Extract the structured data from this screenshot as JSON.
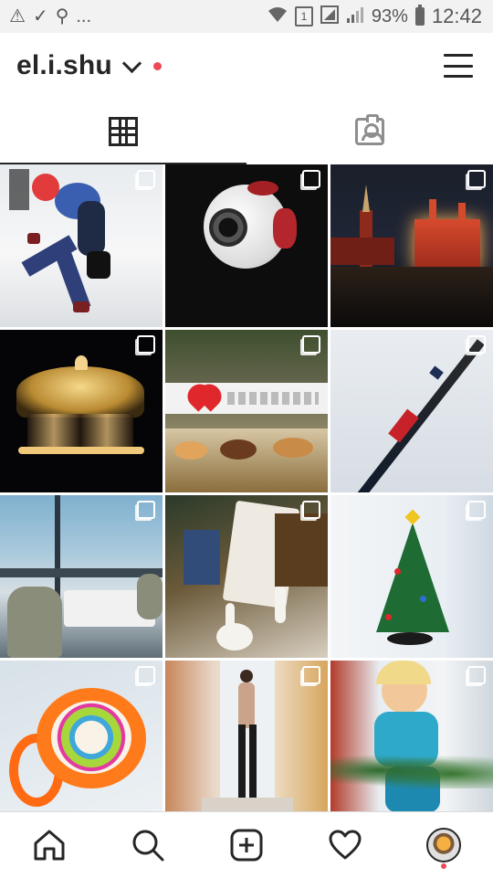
{
  "status_bar": {
    "left_icons": [
      "warning-icon",
      "check-icon",
      "search-icon"
    ],
    "ellipsis": "...",
    "sim_label": "1",
    "battery_percent": "93%",
    "time": "12:42"
  },
  "header": {
    "username": "el.i.shu",
    "has_notification_dot": true
  },
  "tabs": [
    {
      "name": "grid",
      "icon": "grid-icon",
      "active": true
    },
    {
      "name": "tagged",
      "icon": "tagged-photos-icon",
      "active": false
    }
  ],
  "photos": [
    {
      "subject": "girl jumping with balloons",
      "multi": true
    },
    {
      "subject": "giant eyeball sculpture",
      "multi": true
    },
    {
      "subject": "red square kremlin at night",
      "multi": true
    },
    {
      "subject": "carousel lights at night",
      "multi": true
    },
    {
      "subject": "cafe sign with heart and pastries",
      "multi": true
    },
    {
      "subject": "tv tower against winter sky",
      "multi": true
    },
    {
      "subject": "restaurant window view",
      "multi": true
    },
    {
      "subject": "cafe decor with goose figure",
      "multi": true
    },
    {
      "subject": "small christmas tree on windowsill",
      "multi": true
    },
    {
      "subject": "orange handmade brooch",
      "multi": true
    },
    {
      "subject": "girl posing by window",
      "multi": true
    },
    {
      "subject": "child with pine branches",
      "multi": true
    }
  ],
  "bottom_nav": [
    {
      "name": "home",
      "icon": "home-icon"
    },
    {
      "name": "search",
      "icon": "search-icon"
    },
    {
      "name": "new-post",
      "icon": "plus-square-icon"
    },
    {
      "name": "activity",
      "icon": "heart-icon"
    },
    {
      "name": "profile",
      "icon": "profile-avatar-icon",
      "has_dot": true
    }
  ],
  "colors": {
    "text": "#262626",
    "muted": "#8e8e8e",
    "notification": "#ed4956",
    "status_bar_bg": "#f2f2f2"
  }
}
